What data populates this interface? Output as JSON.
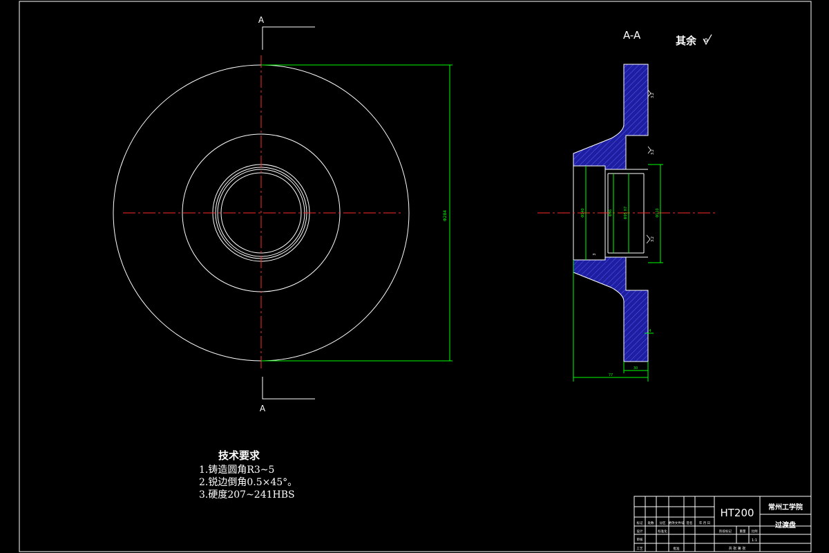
{
  "drawing": {
    "section_marks": {
      "top_label": "A",
      "bottom_label": "A"
    },
    "section_view": {
      "title": "A-A",
      "roughness_note": "其余"
    },
    "dimensions": {
      "front_height": "Φ284",
      "inner_d1": "Φ140",
      "inner_d2": "Φ96",
      "inner_d3": "Φ95 H7",
      "inner_d4": "Φ110",
      "hub_length": "77",
      "flange_thickness": "30",
      "small_step": "4",
      "small_gap": "3",
      "roughness_a": "3.2",
      "roughness_b": "3.2",
      "roughness_c": "3.2"
    }
  },
  "tech_requirements": {
    "title": "技术要求",
    "lines": [
      "1.铸造圆角R3~5",
      "2.锐边倒角0.5×45°。",
      "3.硬度207~241HBS"
    ]
  },
  "title_block": {
    "material": "HT200",
    "school": "常州工学院",
    "part_name": "过渡盘",
    "scale": "1:1",
    "sheet_note": "共 张 第 张",
    "header_cells": [
      "标记",
      "处数",
      "分区",
      "更改文件号",
      "签名",
      "年 月 日"
    ],
    "row_labels": [
      "设计",
      "审核",
      "工艺",
      "标准化",
      "批准"
    ],
    "col_labels": [
      "阶段标记",
      "重量",
      "比例"
    ]
  },
  "colors": {
    "background": "#000000",
    "outline": "#ffffff",
    "centerline": "#ff2a2a",
    "dimension": "#00ff00",
    "hatch": "#1e1ea0"
  }
}
